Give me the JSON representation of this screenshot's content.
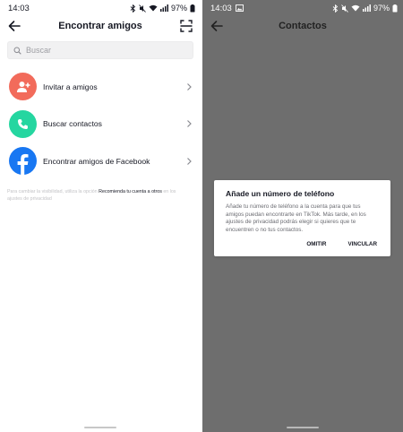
{
  "left": {
    "status": {
      "time": "14:03",
      "battery": "97%"
    },
    "header": {
      "title": "Encontrar amigos"
    },
    "search": {
      "placeholder": "Buscar"
    },
    "items": [
      {
        "label": "Invitar a amigos",
        "icon": "add-user-icon",
        "color": "#f26b5b"
      },
      {
        "label": "Buscar contactos",
        "icon": "phone-icon",
        "color": "#25d6a0"
      },
      {
        "label": "Encontrar amigos de Facebook",
        "icon": "facebook-icon",
        "color": "#1877f2"
      }
    ],
    "footnote": {
      "text_before": "Para cambiar la visibilidad, utiliza la opción ",
      "highlight": "Recomienda tu cuenta a otros",
      "text_after": " en los ajustes de privacidad"
    }
  },
  "right": {
    "status": {
      "time": "14:03",
      "battery": "97%"
    },
    "header": {
      "title": "Contactos"
    },
    "dialog": {
      "title": "Añade un número de teléfono",
      "body": "Añade tu número de teléfono a la cuenta para que tus amigos puedan encontrarte en TikTok. Más tarde, en los ajustes de privacidad podrás elegir si quieres que te encuentren o no tus contactos.",
      "cancel": "OMITIR",
      "confirm": "VINCULAR"
    }
  }
}
